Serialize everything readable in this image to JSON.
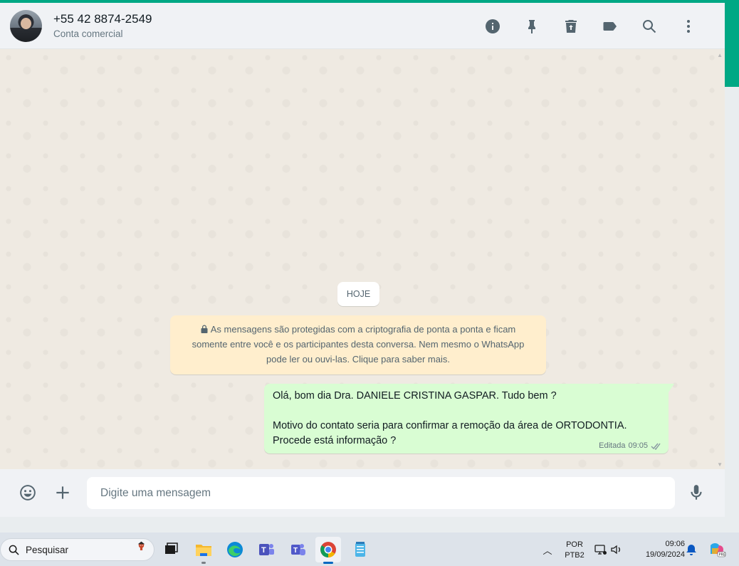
{
  "header": {
    "contact_name": "+55 42 8874-2549",
    "contact_subtitle": "Conta comercial",
    "icons": [
      "info-icon",
      "pin-icon",
      "delete-icon",
      "label-icon",
      "search-icon",
      "menu-icon"
    ]
  },
  "chat": {
    "date_chip": "HOJE",
    "encryption_notice": {
      "line1": "As mensagens são protegidas com a criptografia de ponta a ponta e ficam",
      "line2": "somente entre você e os participantes desta conversa. Nem mesmo o WhatsApp",
      "line3": "pode ler ou ouvi-las. Clique para saber mais."
    },
    "outgoing_message": {
      "line1": "Olá, bom dia Dra. DANIELE CRISTINA GASPAR. Tudo bem ?",
      "line2": "Motivo do contato seria para confirmar a remoção da área de ORTODONTIA.",
      "line3": "Procede está informação ?",
      "edited_label": "Editada",
      "time": "09:05",
      "status": "read"
    }
  },
  "composer": {
    "placeholder": "Digite uma mensagem"
  },
  "taskbar": {
    "search_label": "Pesquisar",
    "apps": [
      "task-view",
      "file-explorer",
      "edge",
      "teams-classic",
      "teams",
      "chrome",
      "notepad"
    ],
    "tray": {
      "lang_line1": "POR",
      "lang_line2": "PTB2",
      "time": "09:06",
      "date": "19/09/2024"
    }
  },
  "colors": {
    "accent": "#00a884",
    "outgoing_bubble": "#d9fdd3",
    "notice_bg": "#ffeecd",
    "chat_bg": "#efeae2"
  }
}
